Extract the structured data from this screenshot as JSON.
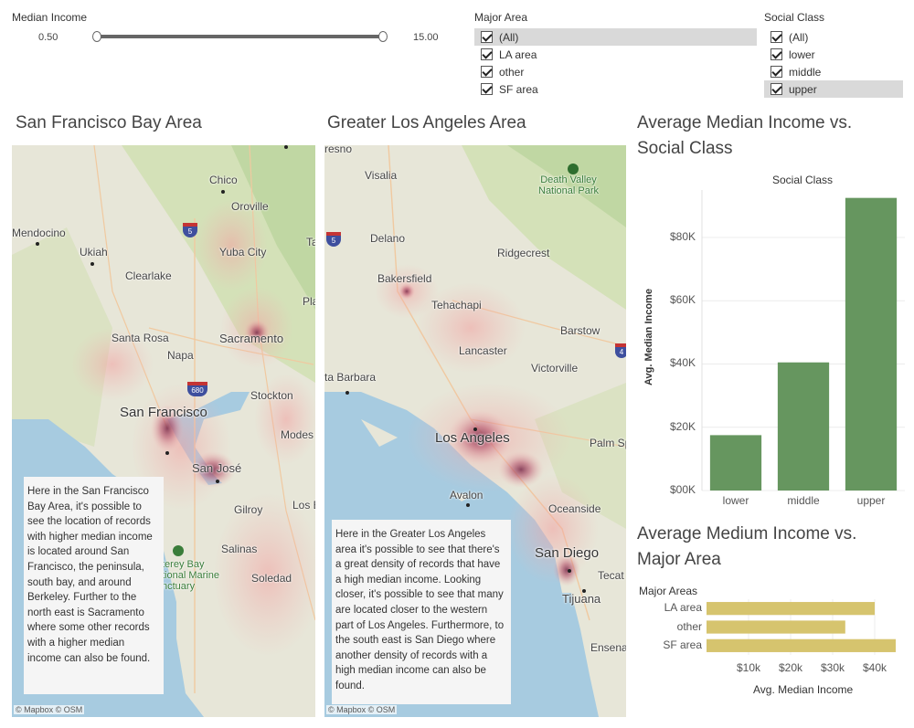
{
  "filters": {
    "median_income": {
      "title": "Median Income",
      "min_label": "0.50",
      "max_label": "15.00"
    },
    "major_area": {
      "title": "Major Area",
      "options": [
        {
          "label": "(All)",
          "checked": true,
          "highlighted": true
        },
        {
          "label": "LA area",
          "checked": true,
          "highlighted": false
        },
        {
          "label": "other",
          "checked": true,
          "highlighted": false
        },
        {
          "label": "SF area",
          "checked": true,
          "highlighted": false
        }
      ]
    },
    "social_class": {
      "title": "Social Class",
      "options": [
        {
          "label": "(All)",
          "checked": true,
          "highlighted": false
        },
        {
          "label": "lower",
          "checked": true,
          "highlighted": false
        },
        {
          "label": "middle",
          "checked": true,
          "highlighted": false
        },
        {
          "label": "upper",
          "checked": true,
          "highlighted": true
        }
      ]
    }
  },
  "sf_map": {
    "title": "San Francisco Bay Area",
    "labels": {
      "chico": "Chico",
      "oroville": "Oroville",
      "mendocino": "Mendocino",
      "ukiah": "Ukiah",
      "yuba_city": "Yuba City",
      "clearlake": "Clearlake",
      "santa_rosa": "Santa Rosa",
      "sacramento": "Sacramento",
      "napa": "Napa",
      "stockton": "Stockton",
      "san_francisco": "San Francisco",
      "modes": "Modes",
      "san_jose": "San José",
      "gilroy": "Gilroy",
      "los_b": "Los B",
      "salinas": "Salinas",
      "soledad": "Soledad",
      "monterey": "terey Bay",
      "monterey2": "tional Marine",
      "monterey3": "nctuary",
      "ta": "Ta",
      "pla": "Pla",
      "i5": "5",
      "i680": "680"
    },
    "annotation": "Here in the San Francisco Bay Area, it's possible to see the location of records with higher median income is located around San Francisco, the peninsula, south bay, and around Berkeley. Further to the north east is Sacramento where some other records with a higher median income can also be found.",
    "attribution": "© Mapbox © OSM"
  },
  "la_map": {
    "title": "Greater Los Angeles Area",
    "labels": {
      "fresno": "resno",
      "visalia": "Visalia",
      "death_valley": "Death Valley",
      "death_valley2": "National Park",
      "delano": "Delano",
      "ridgecrest": "Ridgecrest",
      "bakersfield": "Bakersfield",
      "tehachapi": "Tehachapi",
      "barstow": "Barstow",
      "lancaster": "Lancaster",
      "victorville": "Victorville",
      "santa_barbara": "ta Barbara",
      "los_angeles": "Los Angeles",
      "palm_sp": "Palm Sp",
      "avalon": "Avalon",
      "oceanside": "Oceanside",
      "san_diego": "San Diego",
      "tecate": "Tecat",
      "tijuana": "Tijuana",
      "ensenada": "Ensena",
      "i5": "5",
      "i4": "4"
    },
    "annotation": "Here in the Greater Los Angeles area it's possible to see that there's a great density of records that have a high median income. Looking closer, it's possible to see that many are located closer to the western part of Los Angeles. Furthermore, to the south east is San Diego where another density of records with a high median income can also be found.",
    "attribution": "© Mapbox © OSM"
  },
  "chart_data": [
    {
      "type": "bar",
      "title": "Average Median Income vs. Social Class",
      "header": "Social Class",
      "categories": [
        "lower",
        "middle",
        "upper"
      ],
      "values": [
        17500,
        40500,
        92500
      ],
      "ylabel": "Avg. Median Income",
      "yticks": [
        "$00K",
        "$20K",
        "$40K",
        "$60K",
        "$80K"
      ],
      "ytick_values": [
        0,
        20000,
        40000,
        60000,
        80000
      ],
      "ylim": [
        0,
        95000
      ],
      "grid": true,
      "color": "#66965f"
    },
    {
      "type": "bar",
      "orientation": "horizontal",
      "title": "Average Medium Income vs. Major Area",
      "header": "Major Areas",
      "categories": [
        "LA area",
        "other",
        "SF area"
      ],
      "values": [
        40000,
        33000,
        45000
      ],
      "xlabel": "Avg. Median Income",
      "xticks": [
        "$10k",
        "$20k",
        "$30k",
        "$40k"
      ],
      "xtick_values": [
        10000,
        20000,
        30000,
        40000
      ],
      "xlim": [
        0,
        45000
      ],
      "grid": true,
      "color": "#d6c46e"
    }
  ]
}
